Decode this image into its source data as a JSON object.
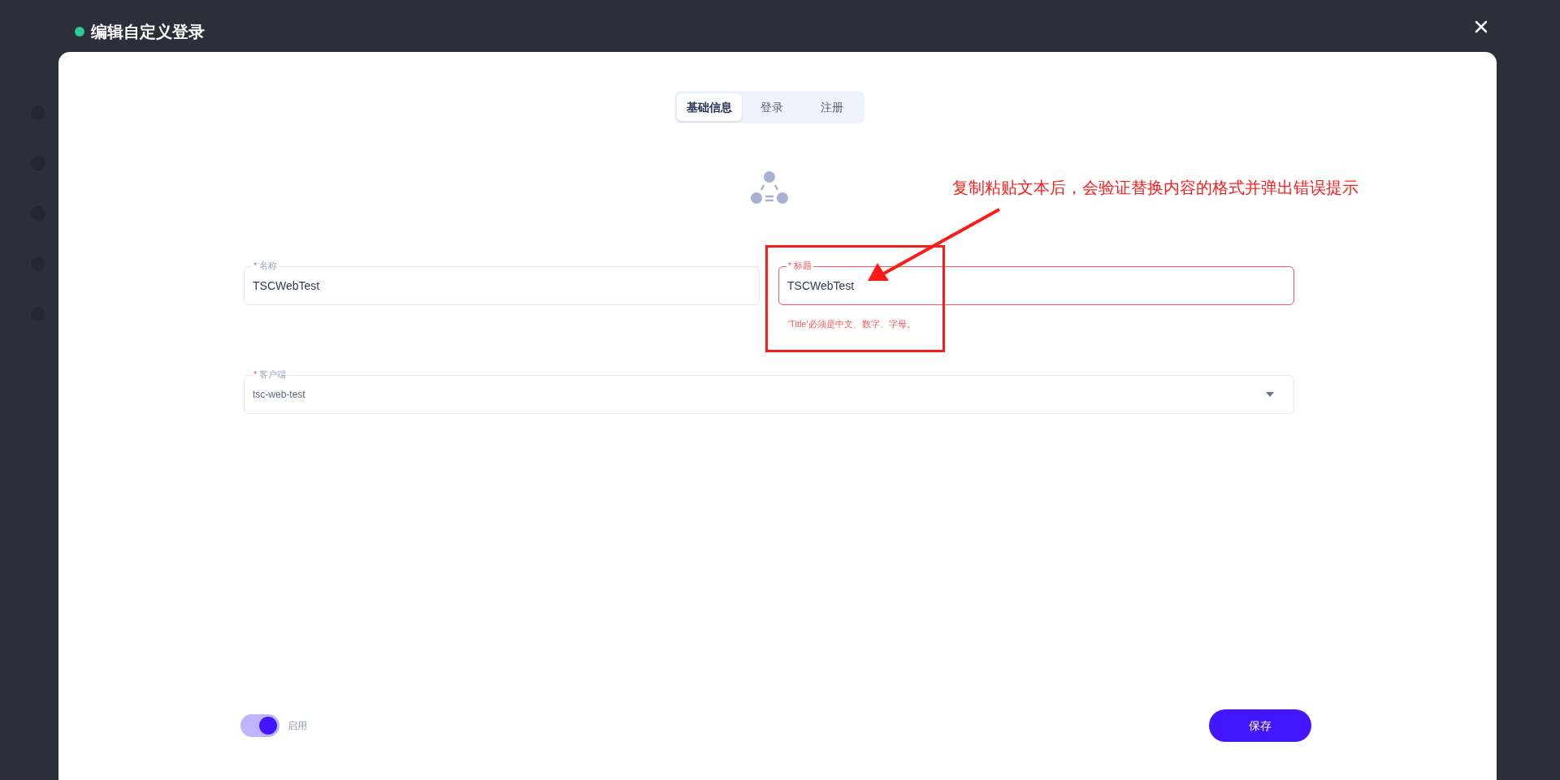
{
  "dialog": {
    "title": "编辑自定义登录"
  },
  "tabs": [
    {
      "label": "基础信息",
      "selected": true
    },
    {
      "label": "登录",
      "selected": false
    },
    {
      "label": "注册",
      "selected": false
    }
  ],
  "fields": [
    {
      "kind": "text",
      "required_mark": "*",
      "label": "名称",
      "value": "TSCWebTest"
    },
    {
      "kind": "text",
      "required_mark": "*",
      "label": "标题",
      "value": "TSCWebTest",
      "error": "'Title'必须是中文、数字、字母。"
    },
    {
      "kind": "select",
      "required_mark": "*",
      "label": "客户端",
      "value": "tsc-web-test"
    }
  ],
  "toggle": {
    "label": "启用",
    "on": true
  },
  "save_button": "保存",
  "annotation": "复制粘贴文本后，会验证替换内容的格式并弹出错误提示"
}
